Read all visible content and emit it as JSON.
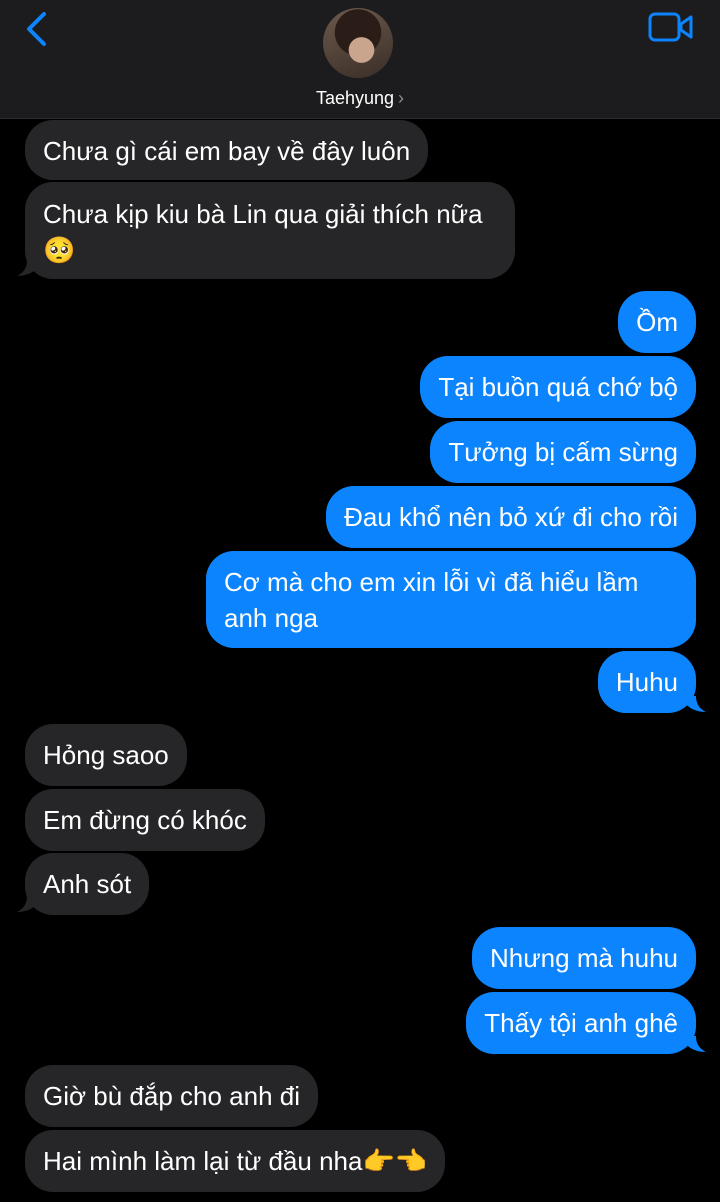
{
  "header": {
    "contact_name": "Taehyung",
    "chevron": "›",
    "back_icon": "chevron-left-icon",
    "video_icon": "video-camera-icon",
    "accent_color": "#0b84fe"
  },
  "messages": [
    {
      "side": "in",
      "text": "Chưa gì cái em bay về đây luôn"
    },
    {
      "side": "in",
      "text": "Chưa kịp kiu bà Lin qua giải thích nữa 🥺"
    },
    {
      "side": "out",
      "text": "Ồm"
    },
    {
      "side": "out",
      "text": "Tại buồn quá chớ bộ"
    },
    {
      "side": "out",
      "text": "Tưởng bị cấm sừng"
    },
    {
      "side": "out",
      "text": "Đau khổ nên bỏ xứ đi cho rồi"
    },
    {
      "side": "out",
      "text": "Cơ mà cho em xin lỗi vì đã hiểu lầm anh nga"
    },
    {
      "side": "out",
      "text": "Huhu"
    },
    {
      "side": "in",
      "text": "Hỏng saoo"
    },
    {
      "side": "in",
      "text": "Em đừng có khóc"
    },
    {
      "side": "in",
      "text": "Anh sót"
    },
    {
      "side": "out",
      "text": "Nhưng mà huhu"
    },
    {
      "side": "out",
      "text": "Thấy tội anh ghê"
    },
    {
      "side": "in",
      "text": "Giờ bù đắp cho anh đi"
    },
    {
      "side": "in",
      "text": "Hai mình làm lại từ đầu nha👉👈"
    }
  ]
}
